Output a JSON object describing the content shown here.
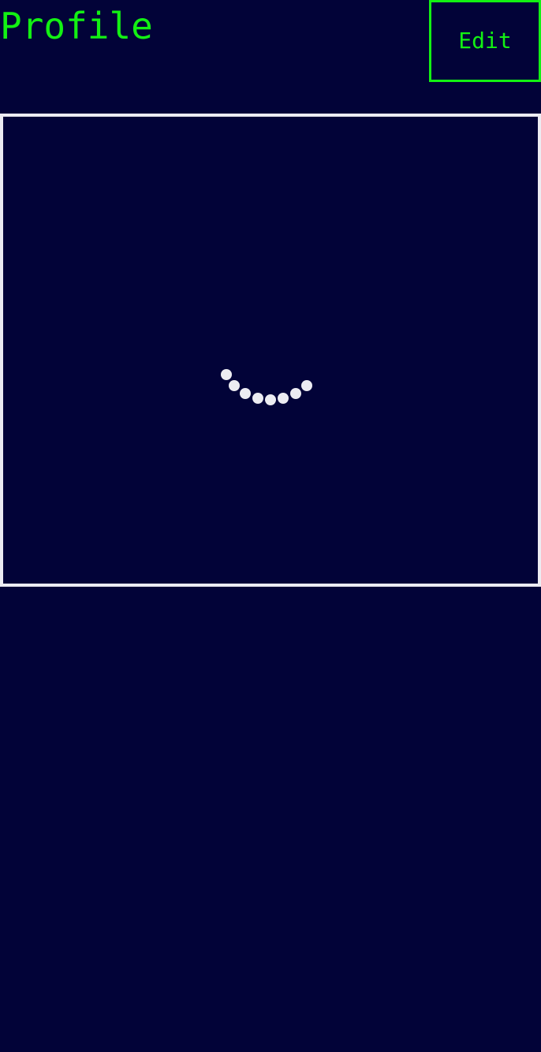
{
  "header": {
    "title": "Profile",
    "edit_label": "Edit"
  },
  "profile_image": {
    "state": "loading",
    "spinner_icon": "loading-spinner-icon"
  },
  "colors": {
    "background": "#020338",
    "accent": "#13f113",
    "frame": "#ececf2",
    "spinner": "#ececf2"
  }
}
